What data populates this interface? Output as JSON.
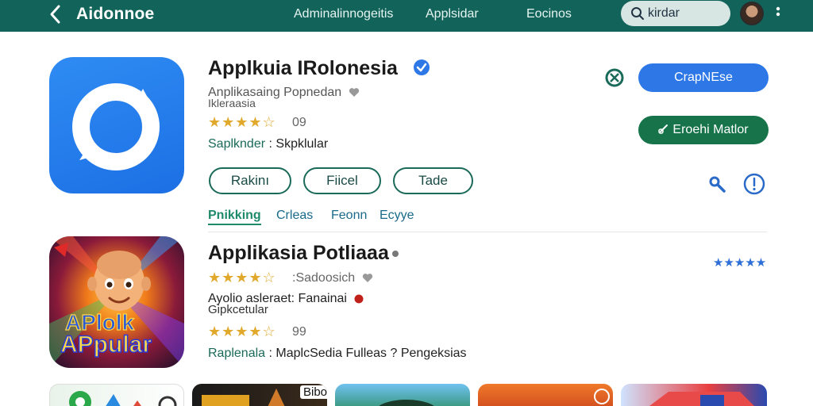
{
  "header": {
    "title": "Aidonnoe",
    "nav": [
      "Adminalinnogeitis",
      "Applsidar",
      "Eocinos"
    ],
    "search_value": "kirdar",
    "back_icon": "chevron-left-icon",
    "more_icon": "vertical-dots-icon",
    "bar_color": "#12645a"
  },
  "app1": {
    "title": "Applkuia IRolonesia",
    "subtitle": "Anplikasaing Popnedan",
    "subtitle2": "Ikleraasia",
    "rating": "09",
    "stars": "★★★★☆",
    "meta_key": "Saplknder",
    "meta_sep": ":",
    "meta_value": "Skpklular",
    "pills": [
      "Rakinı",
      "Fiicel",
      "Tade"
    ],
    "primary_button": "CrapNEse",
    "secondary_button": "Eroehi Matlor",
    "primary_color": "#2d78e6",
    "secondary_color": "#17744a"
  },
  "tabs": [
    "Pnikking",
    "Crleas",
    "Feonn",
    "Ecyye"
  ],
  "app2": {
    "title": "Applikasia Potliaaa",
    "stars": "★★★★☆",
    "rating_text": ":Sadoosich",
    "subtitle": "Ayolio asleraet: Fanainai",
    "subtitle2": "Gipkcetular",
    "stars2": "★★★★☆",
    "rating2": "99",
    "meta_key": "Raplenala",
    "meta_sep": ":",
    "meta_value": "MaplcSedia Fulleas ? Pengeksias",
    "right_stars": "★★★★★",
    "icon_text_1": "APlolk",
    "icon_text_2": "APpular"
  },
  "bottom": {
    "thumb2_label": "Bibonsys"
  }
}
